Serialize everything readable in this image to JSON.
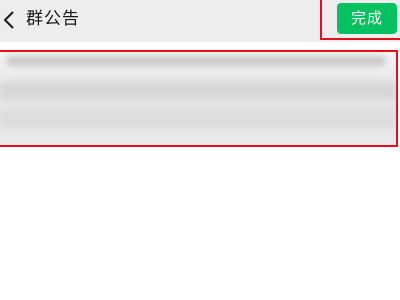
{
  "nav": {
    "back_icon": "chevron-left-icon",
    "title": "群公告",
    "done_label": "完成"
  },
  "colors": {
    "nav_background": "#ededed",
    "done_button": "#07c160",
    "highlight_border": "#e0101e"
  },
  "announcement": {
    "content_blurred": true
  }
}
